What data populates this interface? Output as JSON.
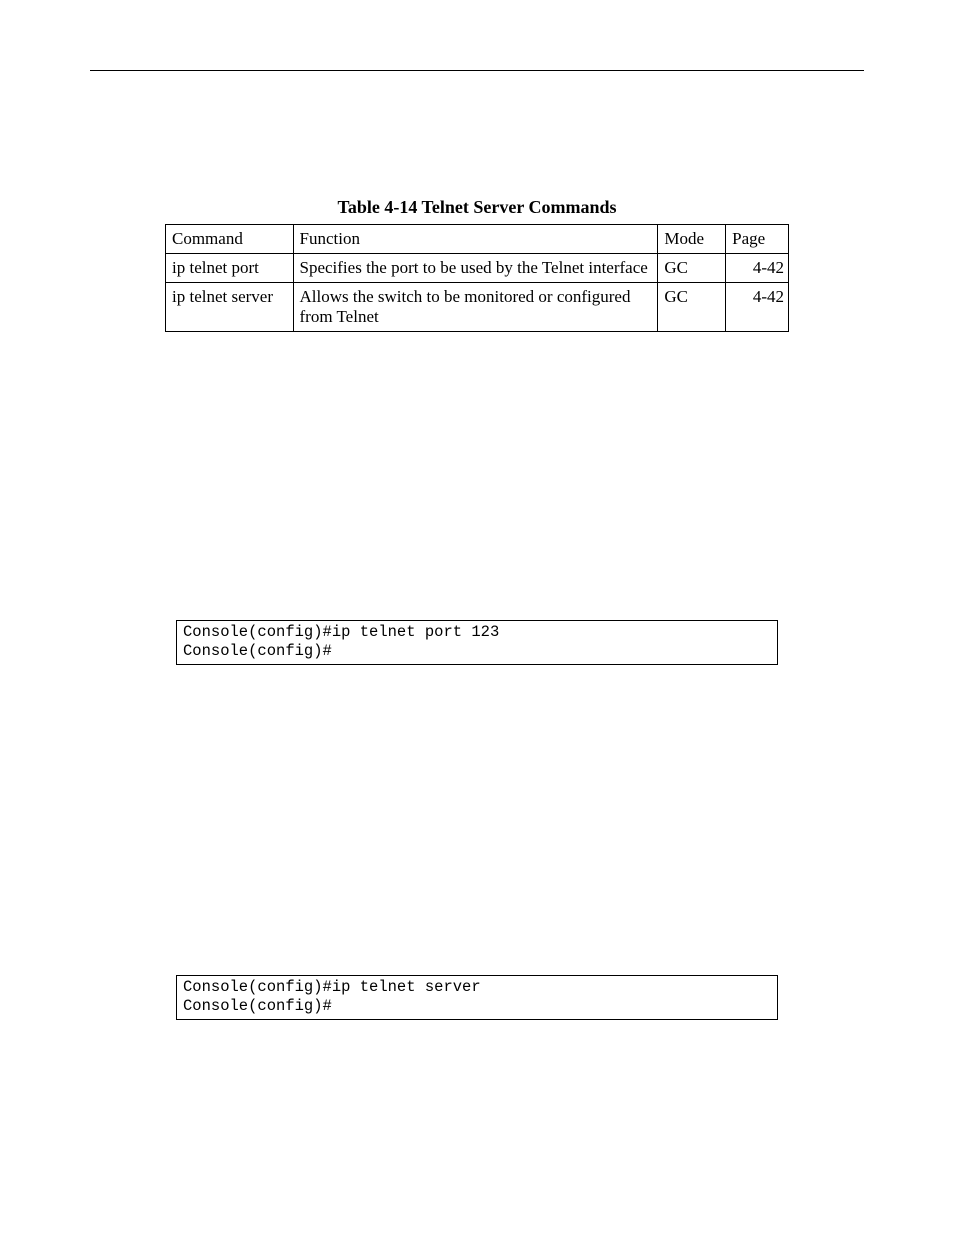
{
  "caption": "Table 4-14  Telnet Server Commands",
  "headers": {
    "command": "Command",
    "function": "Function",
    "mode": "Mode",
    "page": "Page"
  },
  "rows": [
    {
      "command": "ip telnet port",
      "function": "Specifies the port to be used by the Telnet interface",
      "mode": "GC",
      "page": "4-42"
    },
    {
      "command": "ip telnet server",
      "function": "Allows the switch to be monitored or configured from Telnet",
      "mode": "GC",
      "page": "4-42"
    }
  ],
  "code1": "Console(config)#ip telnet port 123\nConsole(config)#",
  "code2": "Console(config)#ip telnet server\nConsole(config)#"
}
